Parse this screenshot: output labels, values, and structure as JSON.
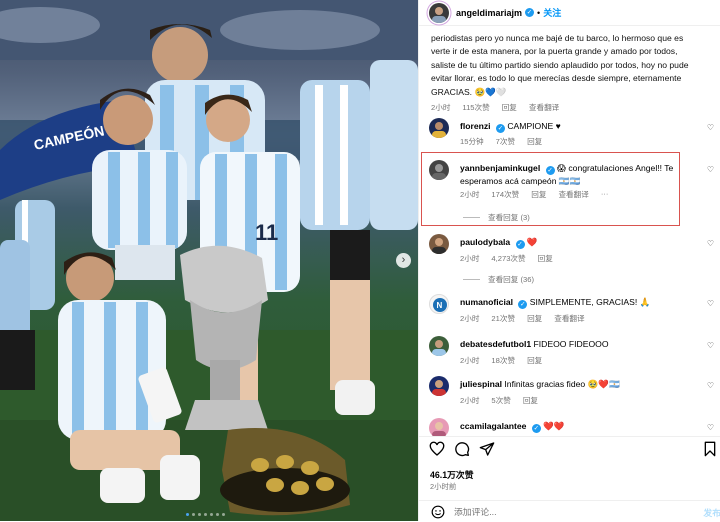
{
  "post": {
    "author": "angeldimariajm",
    "follow_label": "关注",
    "separator": "•",
    "caption_text": "periodistas pero yo nunca me bajé de tu barco, lo hermoso que es verte ir de esta manera, por la puerta grande y amado por todos, saliste de tu último partido siendo aplaudido por todos, hoy no pude evitar llorar, es todo lo que merecías desde siempre, eternamente GRACIAS. 🥹💙🤍",
    "caption_meta": {
      "time": "2小时",
      "likes": "115次赞",
      "reply": "回复",
      "translate": "查看翻译"
    }
  },
  "comments": [
    {
      "user": "florenzi",
      "verified": true,
      "text": "CAMPIONE ♥",
      "time": "15分钟",
      "likes": "7次赞",
      "reply": "回复",
      "more": "",
      "view_replies": ""
    },
    {
      "user": "yannbenjaminkugel",
      "verified": true,
      "text": "😱 congratulaciones Angel!! Te esperamos acá campeón 🇦🇷🇦🇷",
      "time": "2小时",
      "likes": "174次赞",
      "reply": "回复",
      "translate": "查看翻译",
      "more": "···",
      "view_replies": "查看回复 (3)"
    },
    {
      "user": "paulodybala",
      "verified": true,
      "text": "❤️",
      "time": "2小时",
      "likes": "4,273次赞",
      "reply": "回复",
      "more": "",
      "view_replies": "查看回复 (36)"
    },
    {
      "user": "numanoficial",
      "verified": true,
      "text": "SIMPLEMENTE, GRACIAS! 🙏",
      "time": "2小时",
      "likes": "21次赞",
      "reply": "回复",
      "translate": "查看翻译",
      "more": "",
      "view_replies": ""
    },
    {
      "user": "debatesdefutbol1",
      "verified": false,
      "text": "FIDEOO FIDEOOO",
      "time": "2小时",
      "likes": "18次赞",
      "reply": "回复",
      "more": "",
      "view_replies": ""
    },
    {
      "user": "juliespinal",
      "verified": false,
      "text": "Infinitas gracias fideo 🥹❤️🇦🇷",
      "time": "2小时",
      "likes": "5次赞",
      "reply": "回复",
      "more": "",
      "view_replies": ""
    },
    {
      "user": "ccamilagalantee",
      "verified": true,
      "text": "❤️❤️",
      "time": "",
      "likes": "",
      "reply": "",
      "more": "",
      "view_replies": ""
    }
  ],
  "actions": {
    "likes_count": "46.1万次赞",
    "posted_time": "2小时前",
    "add_comment_placeholder": "添加评论...",
    "post_label": "发布",
    "icons": [
      "heart-icon",
      "comment-icon",
      "share-icon",
      "bookmark-icon"
    ]
  },
  "photo": {
    "carousel_total": 7,
    "carousel_active": 1,
    "next_arrow": "›"
  },
  "colors": {
    "accent": "#0095f6",
    "verified": "#1d9bf0",
    "highlight": "#d9534f",
    "like_red": "#ed4956"
  }
}
